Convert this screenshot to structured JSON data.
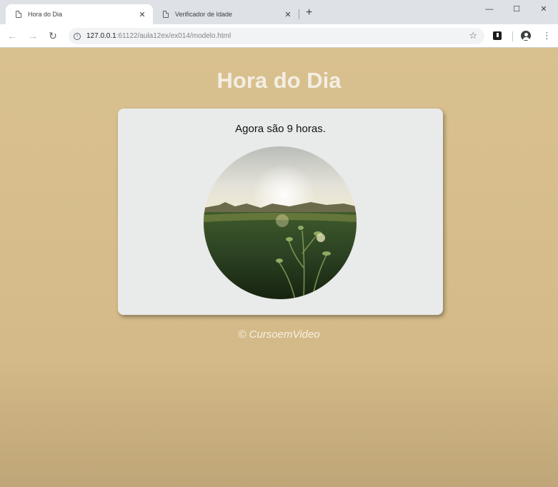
{
  "browser": {
    "tabs": [
      {
        "title": "Hora do Dia",
        "active": true
      },
      {
        "title": "Verificador de Idade",
        "active": false
      }
    ],
    "new_tab_symbol": "+",
    "window_controls": {
      "minimize": "—",
      "maximize": "☐",
      "close": "✕"
    },
    "nav": {
      "back": "←",
      "forward": "→",
      "reload": "↻"
    },
    "address": {
      "host": "127.0.0.1",
      "path": ":61122/aula12ex/ex014/modelo.html"
    },
    "icons": [
      "page-icon",
      "info-icon",
      "star-icon",
      "extension-icon",
      "profile-icon",
      "menu-icon"
    ]
  },
  "page": {
    "heading": "Hora do Dia",
    "message": "Agora são 9 horas.",
    "footer": "© CursoemVideo",
    "colors": {
      "background": "#d8c08f",
      "card": "#e9eaea",
      "heading": "#f3eee3"
    }
  }
}
